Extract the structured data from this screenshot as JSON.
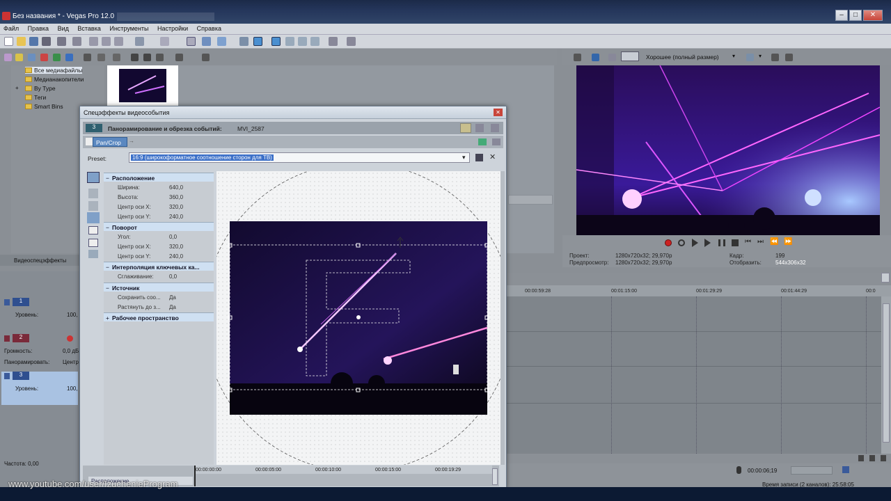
{
  "window": {
    "title": "Без названия * - Vegas Pro 12.0",
    "minimize": "–",
    "maximize": "□",
    "close": "✕"
  },
  "menu": [
    "Файл",
    "Правка",
    "Вид",
    "Вставка",
    "Инструменты",
    "Настройки",
    "Справка"
  ],
  "explorer": {
    "items": [
      "Все медиафайлы",
      "Медианакопители",
      "By Type",
      "Теги",
      "Smart Bins"
    ],
    "expand_glyph": "+"
  },
  "tabs": {
    "video_fx": "Видеоспецэффекты"
  },
  "tracks": [
    {
      "num": "1",
      "level_label": "Уровень:",
      "level_value": "100,"
    },
    {
      "num": "2",
      "vol_label": "Громкость:",
      "vol_value": "0,0 дБ",
      "pan_label": "Панорамировать:",
      "pan_value": "Центр"
    },
    {
      "num": "3",
      "level_label": "Уровень:",
      "level_value": "100,"
    }
  ],
  "rate_label": "Частота: 0,00",
  "watermark": "www.youtube.com/user/IzuchenieProgram",
  "dialog": {
    "title": "Спецэффекты видеособытия",
    "close": "✕",
    "event_label": "Панорамирование и обрезка событий:",
    "event_name": "MVI_2587",
    "chain_tab": "Pan/Crop",
    "preset_label": "Preset:",
    "preset_value": "16:9 (широкоформатное соотношение сторон для ТВ)",
    "sections": {
      "position": "Расположение",
      "rotation": "Поворот",
      "interp": "Интерполяция ключевых ка...",
      "source": "Источник",
      "workspace": "Рабочее пространство"
    },
    "props": {
      "width_k": "Ширина:",
      "width_v": "640,0",
      "height_k": "Высота:",
      "height_v": "360,0",
      "cx_k": "Центр оси X:",
      "cx_v": "320,0",
      "cy_k": "Центр оси Y:",
      "cy_v": "240,0",
      "angle_k": "Угол:",
      "angle_v": "0,0",
      "rcx_k": "Центр оси X:",
      "rcx_v": "320,0",
      "rcy_k": "Центр оси Y:",
      "rcy_v": "240,0",
      "smooth_k": "Сглаживание:",
      "smooth_v": "0,0",
      "keep_k": "Сохранить соо...",
      "keep_v": "Да",
      "stretch_k": "Растянуть до з...",
      "stretch_v": "Да"
    },
    "timeline": {
      "t0": "00:00:00:00",
      "t1": "00:00:05:00",
      "t2": "00:00:10:00",
      "t3": "00:00:15:00",
      "t4": "00:00:19:29",
      "tab": "Расположение"
    }
  },
  "preview": {
    "quality": "Хорошее (полный размер)",
    "project_label": "Проект:",
    "project_value": "1280x720x32; 29,970p",
    "preview_label": "Предпросмотр:",
    "preview_value": "1280x720x32; 29,970p",
    "frame_label": "Кадр:",
    "frame_value": "199",
    "display_label": "Отобразить:",
    "display_value": "544x306x32"
  },
  "timeline": {
    "m1": "00:00:59:28",
    "m2": "00:01:15:00",
    "m3": "00:01:29:29",
    "m4": "00:01:44:29",
    "m5": "00:0",
    "time": "00:00:06;19",
    "record_time": "Время записи (2 каналов): 25:58:05"
  }
}
